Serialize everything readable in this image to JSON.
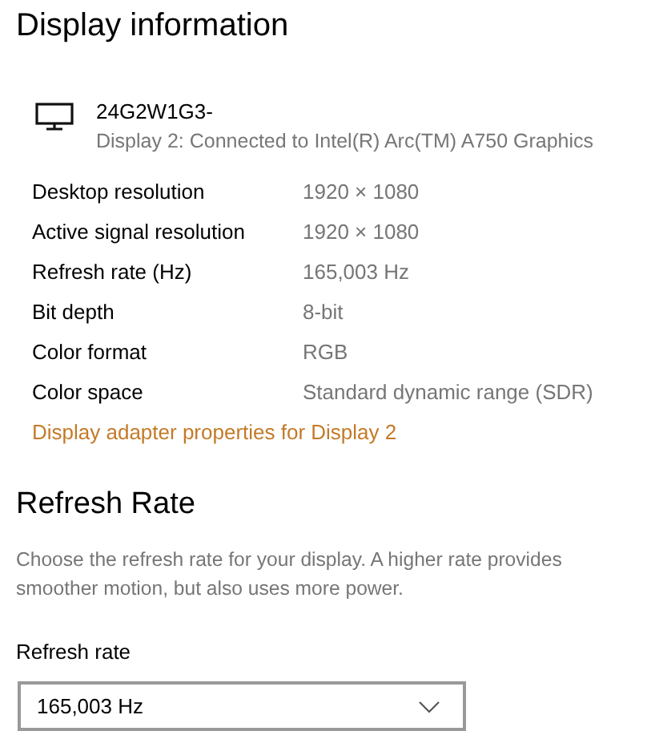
{
  "title": "Display information",
  "monitor": {
    "name": "24G2W1G3-",
    "connection": "Display 2: Connected to Intel(R) Arc(TM) A750 Graphics"
  },
  "properties": [
    {
      "label": "Desktop resolution",
      "value": "1920 × 1080"
    },
    {
      "label": "Active signal resolution",
      "value": "1920 × 1080"
    },
    {
      "label": "Refresh rate (Hz)",
      "value": "165,003 Hz"
    },
    {
      "label": "Bit depth",
      "value": "8-bit"
    },
    {
      "label": "Color format",
      "value": "RGB"
    },
    {
      "label": "Color space",
      "value": "Standard dynamic range (SDR)"
    }
  ],
  "adapter_link": "Display adapter properties for Display 2",
  "refresh_section": {
    "heading": "Refresh Rate",
    "description": "Choose the refresh rate for your display. A higher rate provides smoother motion, but also uses more power.",
    "field_label": "Refresh rate",
    "dropdown_value": "165,003 Hz"
  }
}
